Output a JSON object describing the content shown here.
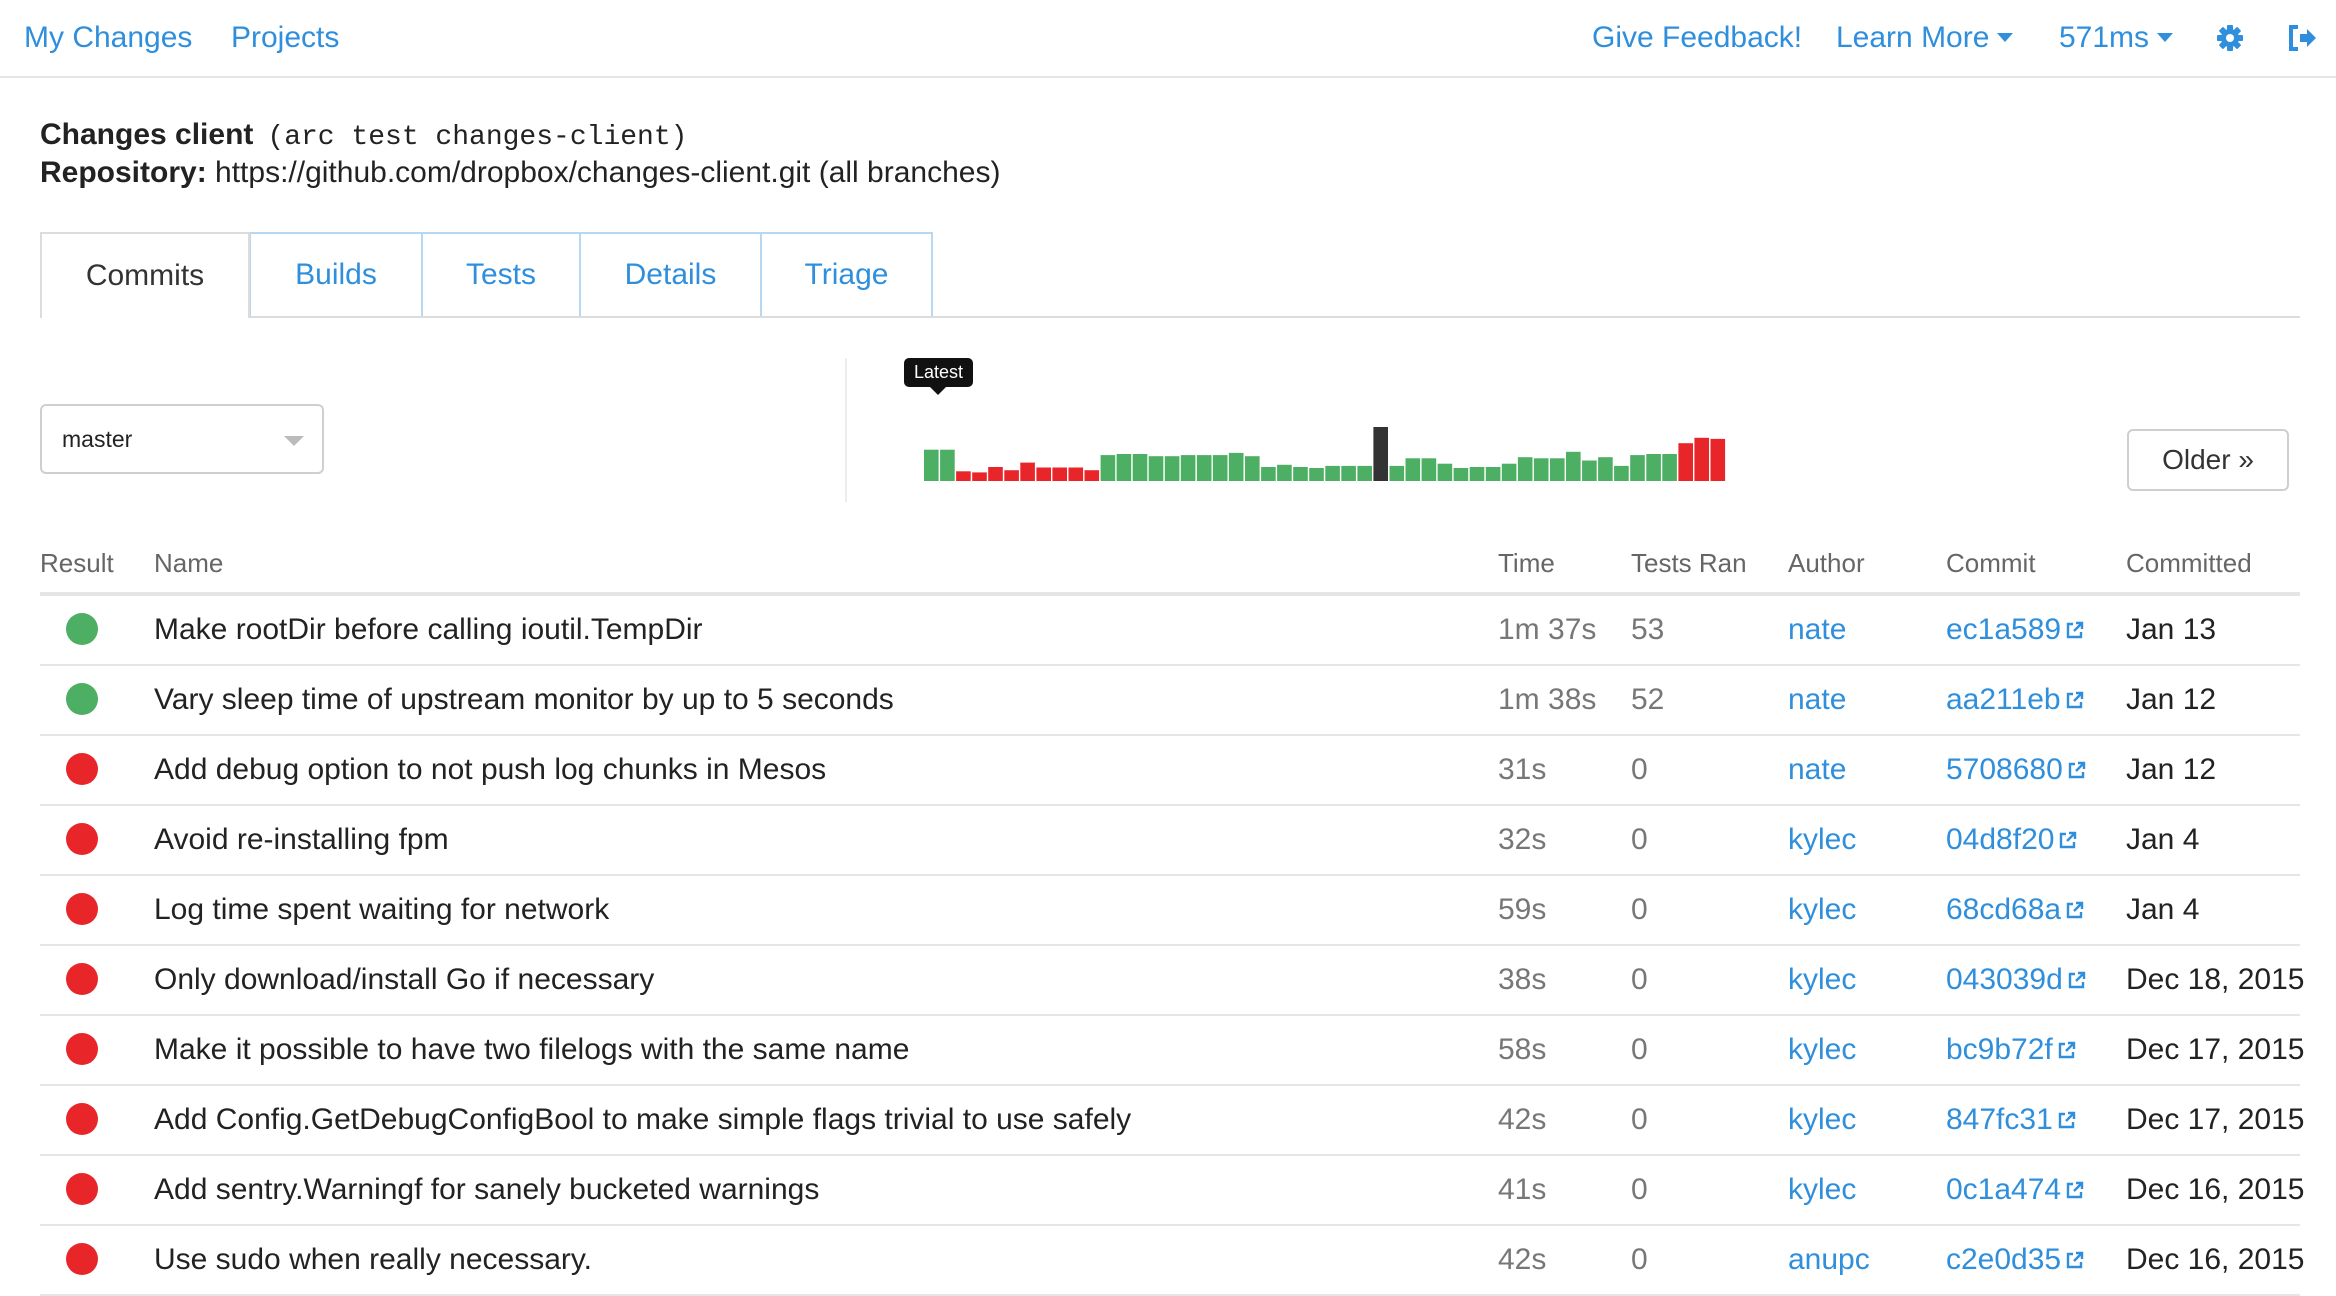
{
  "nav": {
    "my_changes": "My Changes",
    "projects": "Projects",
    "feedback": "Give Feedback!",
    "learn_more": "Learn More",
    "timing": "571ms"
  },
  "header": {
    "title": "Changes client",
    "command": "(arc test changes-client)",
    "repo_label": "Repository:",
    "repo_value": "https://github.com/dropbox/changes-client.git (all branches)"
  },
  "tabs": [
    "Commits",
    "Builds",
    "Tests",
    "Details",
    "Triage"
  ],
  "branch": {
    "selected": "master"
  },
  "history": {
    "latest_label": "Latest",
    "older_label": "Older »",
    "colors": {
      "pass": "#4caf63",
      "fail": "#e8262a",
      "current": "#333333"
    },
    "bars": [
      {
        "s": "pass",
        "h": 0.58
      },
      {
        "s": "pass",
        "h": 0.58
      },
      {
        "s": "fail",
        "h": 0.18
      },
      {
        "s": "fail",
        "h": 0.16
      },
      {
        "s": "fail",
        "h": 0.26
      },
      {
        "s": "fail",
        "h": 0.2
      },
      {
        "s": "fail",
        "h": 0.34
      },
      {
        "s": "fail",
        "h": 0.25
      },
      {
        "s": "fail",
        "h": 0.25
      },
      {
        "s": "fail",
        "h": 0.25
      },
      {
        "s": "fail",
        "h": 0.2
      },
      {
        "s": "pass",
        "h": 0.48
      },
      {
        "s": "pass",
        "h": 0.5
      },
      {
        "s": "pass",
        "h": 0.5
      },
      {
        "s": "pass",
        "h": 0.46
      },
      {
        "s": "pass",
        "h": 0.46
      },
      {
        "s": "pass",
        "h": 0.48
      },
      {
        "s": "pass",
        "h": 0.48
      },
      {
        "s": "pass",
        "h": 0.48
      },
      {
        "s": "pass",
        "h": 0.52
      },
      {
        "s": "pass",
        "h": 0.46
      },
      {
        "s": "pass",
        "h": 0.26
      },
      {
        "s": "pass",
        "h": 0.3
      },
      {
        "s": "pass",
        "h": 0.26
      },
      {
        "s": "pass",
        "h": 0.24
      },
      {
        "s": "pass",
        "h": 0.28
      },
      {
        "s": "pass",
        "h": 0.28
      },
      {
        "s": "pass",
        "h": 0.28
      },
      {
        "s": "current",
        "h": 1.0
      },
      {
        "s": "pass",
        "h": 0.28
      },
      {
        "s": "pass",
        "h": 0.42
      },
      {
        "s": "pass",
        "h": 0.42
      },
      {
        "s": "pass",
        "h": 0.32
      },
      {
        "s": "pass",
        "h": 0.24
      },
      {
        "s": "pass",
        "h": 0.26
      },
      {
        "s": "pass",
        "h": 0.26
      },
      {
        "s": "pass",
        "h": 0.32
      },
      {
        "s": "pass",
        "h": 0.44
      },
      {
        "s": "pass",
        "h": 0.42
      },
      {
        "s": "pass",
        "h": 0.42
      },
      {
        "s": "pass",
        "h": 0.54
      },
      {
        "s": "pass",
        "h": 0.38
      },
      {
        "s": "pass",
        "h": 0.44
      },
      {
        "s": "pass",
        "h": 0.28
      },
      {
        "s": "pass",
        "h": 0.48
      },
      {
        "s": "pass",
        "h": 0.5
      },
      {
        "s": "pass",
        "h": 0.5
      },
      {
        "s": "fail",
        "h": 0.7
      },
      {
        "s": "fail",
        "h": 0.8
      },
      {
        "s": "fail",
        "h": 0.78
      }
    ]
  },
  "table": {
    "headers": {
      "result": "Result",
      "name": "Name",
      "time": "Time",
      "tests": "Tests Ran",
      "author": "Author",
      "commit": "Commit",
      "committed": "Committed"
    },
    "rows": [
      {
        "status": "pass",
        "name": "Make rootDir before calling ioutil.TempDir",
        "time": "1m 37s",
        "tests": "53",
        "author": "nate",
        "commit": "ec1a589",
        "date": "Jan 13"
      },
      {
        "status": "pass",
        "name": "Vary sleep time of upstream monitor by up to 5 seconds",
        "time": "1m 38s",
        "tests": "52",
        "author": "nate",
        "commit": "aa211eb",
        "date": "Jan 12"
      },
      {
        "status": "fail",
        "name": "Add debug option to not push log chunks in Mesos",
        "time": "31s",
        "tests": "0",
        "author": "nate",
        "commit": "5708680",
        "date": "Jan 12"
      },
      {
        "status": "fail",
        "name": "Avoid re-installing fpm",
        "time": "32s",
        "tests": "0",
        "author": "kylec",
        "commit": "04d8f20",
        "date": "Jan 4"
      },
      {
        "status": "fail",
        "name": "Log time spent waiting for network",
        "time": "59s",
        "tests": "0",
        "author": "kylec",
        "commit": "68cd68a",
        "date": "Jan 4"
      },
      {
        "status": "fail",
        "name": "Only download/install Go if necessary",
        "time": "38s",
        "tests": "0",
        "author": "kylec",
        "commit": "043039d",
        "date": "Dec 18, 2015"
      },
      {
        "status": "fail",
        "name": "Make it possible to have two filelogs with the same name",
        "time": "58s",
        "tests": "0",
        "author": "kylec",
        "commit": "bc9b72f",
        "date": "Dec 17, 2015"
      },
      {
        "status": "fail",
        "name": "Add Config.GetDebugConfigBool to make simple flags trivial to use safely",
        "time": "42s",
        "tests": "0",
        "author": "kylec",
        "commit": "847fc31",
        "date": "Dec 17, 2015"
      },
      {
        "status": "fail",
        "name": "Add sentry.Warningf for sanely bucketed warnings",
        "time": "41s",
        "tests": "0",
        "author": "kylec",
        "commit": "0c1a474",
        "date": "Dec 16, 2015"
      },
      {
        "status": "fail",
        "name": "Use sudo when really necessary.",
        "time": "42s",
        "tests": "0",
        "author": "anupc",
        "commit": "c2e0d35",
        "date": "Dec 16, 2015"
      }
    ]
  }
}
